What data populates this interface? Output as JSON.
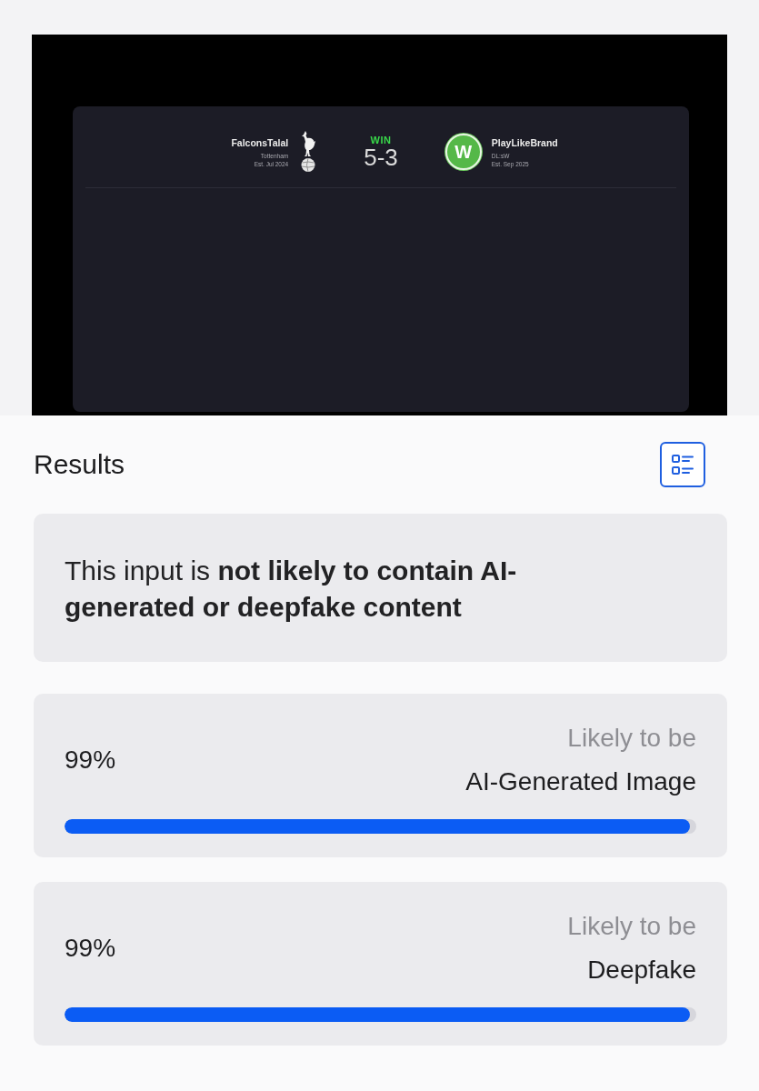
{
  "uploaded_image": {
    "home_team": {
      "name": "FalconsTalal",
      "club": "Tottenham",
      "established": "Est. Jul 2024"
    },
    "result": "WIN",
    "score": "5-3",
    "away_team": {
      "crest_text": "W",
      "name": "PlayLikeBrand",
      "club": "DL:sW",
      "established": "Est. Sep 2025"
    }
  },
  "results": {
    "title": "Results"
  },
  "verdict": {
    "text": "This input is **not likely to contain AI-generated or deepfake content**"
  },
  "scores": [
    {
      "percent": "99%",
      "prefix": "Likely to be",
      "label": "AI-Generated Image",
      "level": 0.99
    },
    {
      "percent": "99%",
      "prefix": "Likely to be",
      "label": "Deepfake",
      "level": 0.99
    }
  ]
}
